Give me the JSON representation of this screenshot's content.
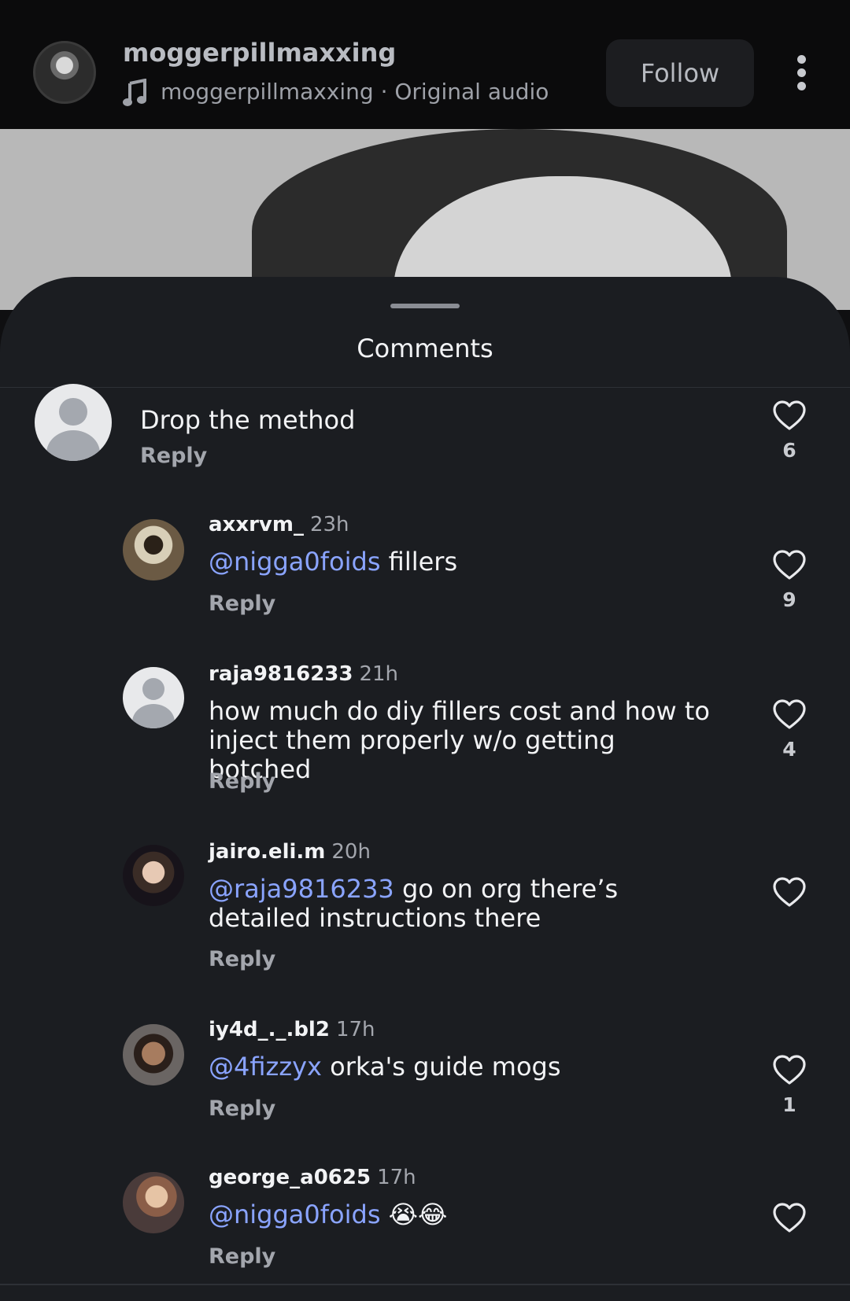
{
  "header": {
    "username": "moggerpillmaxxing",
    "audio": "moggerpillmaxxing · Original audio",
    "follow_label": "Follow"
  },
  "sheet": {
    "title": "Comments"
  },
  "comments": [
    {
      "username": "",
      "time": "",
      "mention": "",
      "text": "Drop the method",
      "reply": "Reply",
      "likes": "6",
      "avatar": "default-avatar"
    },
    {
      "username": "axxrvm_",
      "time": "23h",
      "mention": "@nigga0foids",
      "text": " fillers",
      "reply": "Reply",
      "likes": "9",
      "avatar": "photo-avatar"
    },
    {
      "username": "raja9816233",
      "time": "21h",
      "mention": "",
      "text": "how much do diy fillers cost and how to inject them properly w/o getting botched",
      "reply": "Reply",
      "likes": "4",
      "avatar": "default-avatar"
    },
    {
      "username": "jairo.eli.m",
      "time": "20h",
      "mention": "@raja9816233",
      "text": " go on org there’s detailed instructions there",
      "reply": "Reply",
      "likes": "",
      "avatar": "photo-avatar"
    },
    {
      "username": "iy4d_._.bl2",
      "time": "17h",
      "mention": "@4fizzyx",
      "text": " orka's guide mogs",
      "reply": "Reply",
      "likes": "1",
      "avatar": "photo-avatar"
    },
    {
      "username": "george_a0625",
      "time": "17h",
      "mention": "@nigga0foids",
      "text": " 😭😂",
      "reply": "Reply",
      "likes": "",
      "avatar": "photo-avatar"
    }
  ],
  "icons": {
    "like": "heart-outline-icon",
    "music": "music-note-icon",
    "more": "more-vertical-icon"
  },
  "colors": {
    "mention": "#8aa4ff",
    "sheet_bg": "#1b1d21",
    "follow_bg": "#1c1d20"
  }
}
